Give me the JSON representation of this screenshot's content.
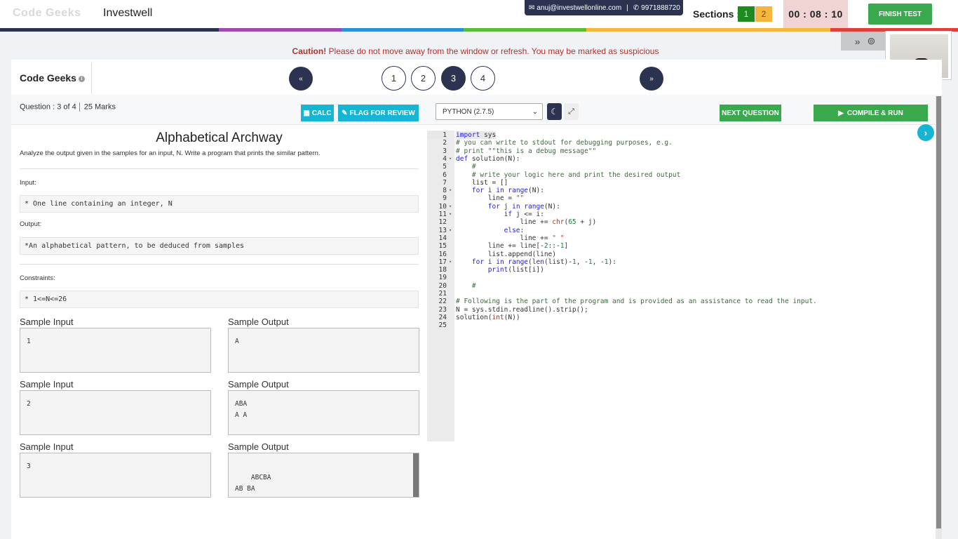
{
  "header": {
    "ghost_logo": "Code Geeks",
    "brand": "Investwell",
    "email": "anuj@investwellonline.com",
    "phone": "9971888720",
    "sections_label": "Sections :",
    "sections": [
      "1",
      "2"
    ],
    "timer": "00 : 08 : 10",
    "finish_label": "FINISH TEST",
    "colors": [
      "#2b3350",
      "#9c4cb0",
      "#2d8fd4",
      "#5dba3b",
      "#f5b63d",
      "#e0403a"
    ]
  },
  "caution": {
    "strong": "Caution!",
    "text": "Please do not move away from the window or refresh. You may be marked as suspicious"
  },
  "panel": {
    "title": "Code Geeks",
    "prev_label": "«",
    "next_label": "»",
    "questions": [
      "1",
      "2",
      "3",
      "4"
    ],
    "active_question": "3",
    "question_meta": "Question : 3 of 4",
    "marks": "25 Marks",
    "calc_label": "CALC",
    "flag_label": "FLAG FOR REVIEW",
    "language": "PYTHON (2.7.5)",
    "next_question_label": "NEXT QUESTION",
    "compile_label": "COMPILE & RUN"
  },
  "question": {
    "title": "Alphabetical Archway",
    "description": "Analyze the output given in the samples for an input, N. Write a program that prints the similar pattern.",
    "input_label": "Input:",
    "input_text": "* One line containing an integer, N",
    "output_label": "Output:",
    "output_text": "*An alphabetical pattern, to be deduced from samples",
    "constraints_label": "Constraints:",
    "constraints_text": "* 1<=N<=26",
    "samples": [
      {
        "input_label": "Sample Input",
        "output_label": "Sample Output",
        "input": "1",
        "output": "A"
      },
      {
        "input_label": "Sample Input",
        "output_label": "Sample Output",
        "input": "2",
        "output": "ABA\nA A"
      },
      {
        "input_label": "Sample Input",
        "output_label": "Sample Output",
        "input": "3",
        "output": "ABCBA\nAB BA\nA   A"
      }
    ]
  },
  "editor": {
    "lines": [
      "import sys",
      "# you can write to stdout for debugging purposes, e.g.",
      "# print \"\"this is a debug message\"\"",
      "def solution(N):",
      "    #",
      "    # write your logic here and print the desired output",
      "    list = []",
      "    for i in range(N):",
      "        line = \"\"",
      "        for j in range(N):",
      "            if j <= i:",
      "                line += chr(65 + j)",
      "            else:",
      "                line += \" \"",
      "        line += line[-2::-1]",
      "        list.append(line)",
      "    for i in range(len(list)-1, -1, -1):",
      "        print(list[i])",
      "",
      "    #",
      "",
      "# Following is the part of the program and is provided as an assistance to read the input.",
      "N = sys.stdin.readline().strip();",
      "solution(int(N))",
      ""
    ],
    "fold_lines": [
      4,
      8,
      10,
      11,
      13,
      17
    ]
  }
}
